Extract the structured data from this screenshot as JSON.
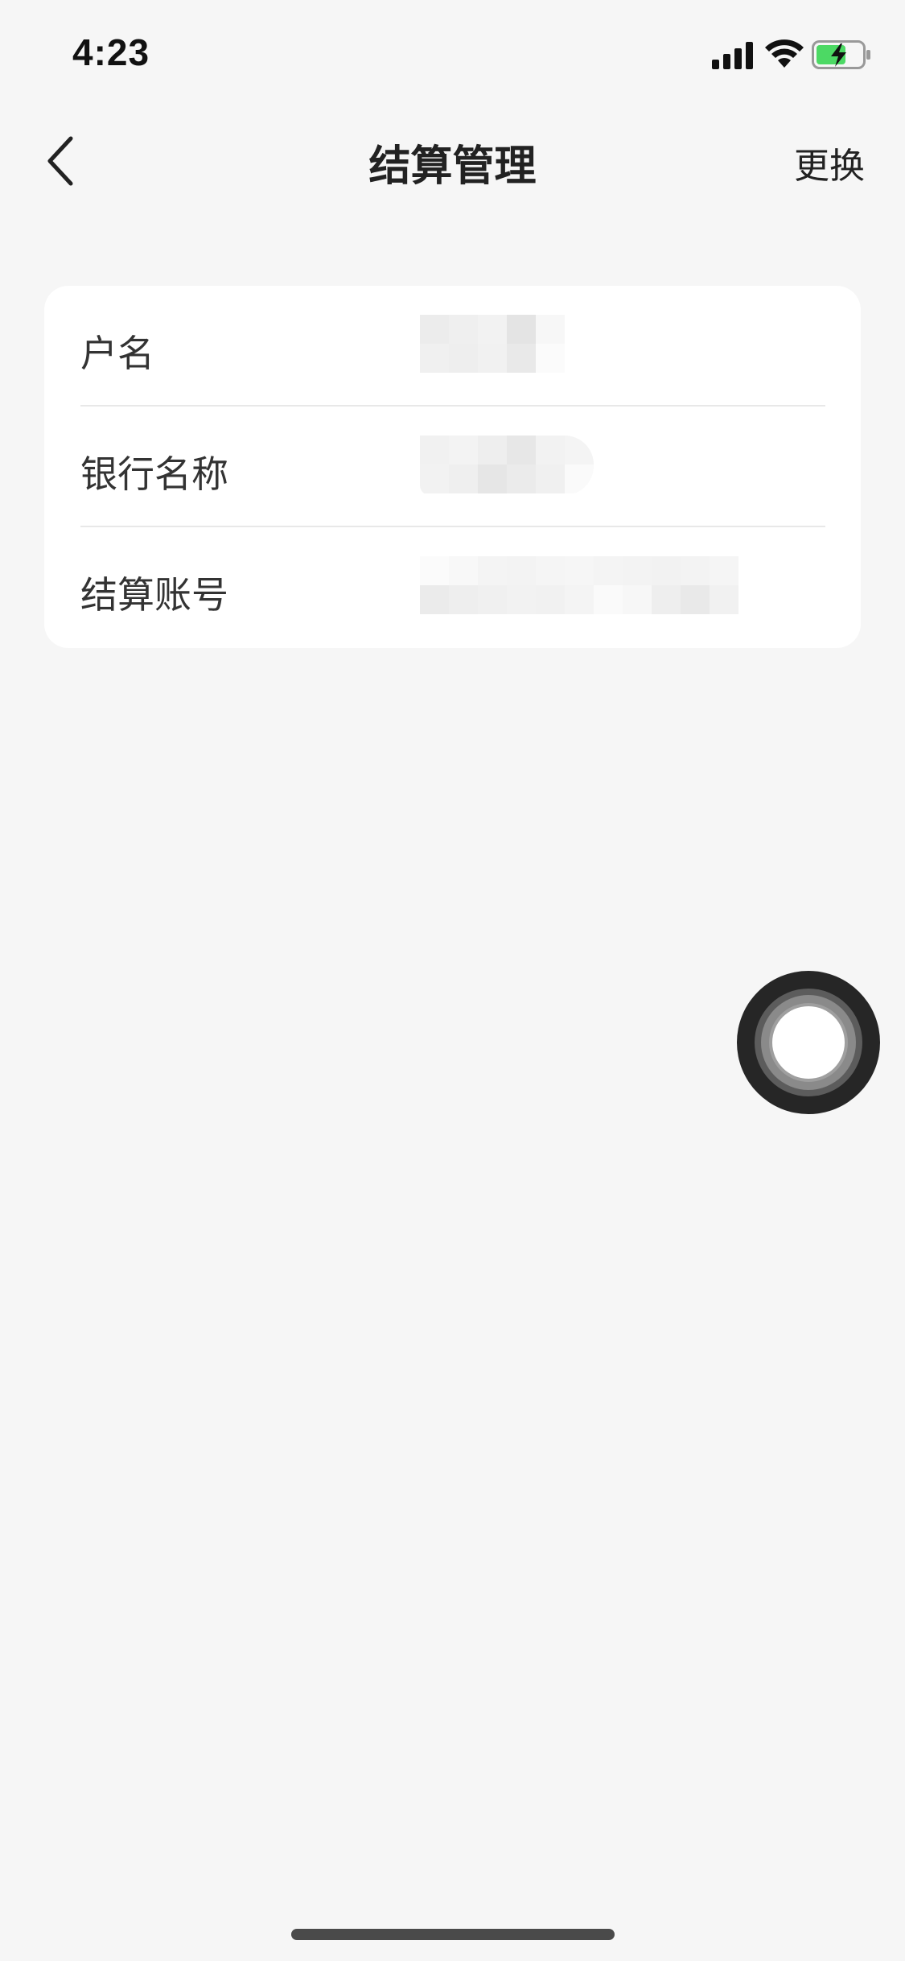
{
  "status_bar": {
    "time": "4:23",
    "signal_icon": "cellular-signal-icon",
    "wifi_icon": "wifi-icon",
    "battery_icon": "battery-charging-icon",
    "battery_color": "#4cd964"
  },
  "nav": {
    "back_icon": "chevron-left-icon",
    "title": "结算管理",
    "action_label": "更换"
  },
  "settlement_info": {
    "rows": [
      {
        "label": "户名"
      },
      {
        "label": "银行名称"
      },
      {
        "label": "结算账号"
      }
    ]
  },
  "assistive_touch": {
    "icon": "assistive-touch-icon"
  },
  "colors": {
    "background": "#f6f6f6",
    "card": "#ffffff",
    "divider": "#e8e8e8",
    "text_primary": "#222222"
  }
}
